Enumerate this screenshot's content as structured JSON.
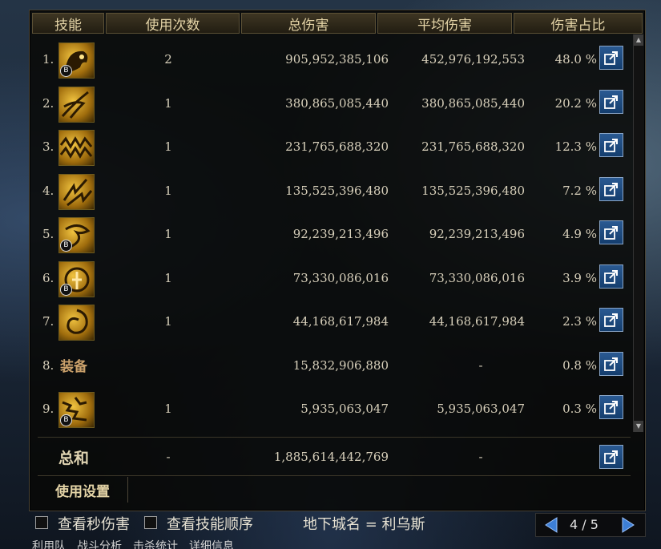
{
  "headers": [
    "技能",
    "使用次数",
    "总伤害",
    "平均伤害",
    "伤害占比"
  ],
  "rows": [
    {
      "rank": "1.",
      "uses": "2",
      "total": "905,952,385,106",
      "avg": "452,976,192,553",
      "pct": "48.0 %",
      "badge": "B",
      "icon": "beast-head-skill-icon"
    },
    {
      "rank": "2.",
      "uses": "1",
      "total": "380,865,085,440",
      "avg": "380,865,085,440",
      "pct": "20.2 %",
      "badge": "",
      "icon": "dragon-slash-skill-icon"
    },
    {
      "rank": "3.",
      "uses": "1",
      "total": "231,765,688,320",
      "avg": "231,765,688,320",
      "pct": "12.3 %",
      "badge": "",
      "icon": "zigzag-wave-skill-icon"
    },
    {
      "rank": "4.",
      "uses": "1",
      "total": "135,525,396,480",
      "avg": "135,525,396,480",
      "pct": "7.2 %",
      "badge": "",
      "icon": "lightning-burst-skill-icon"
    },
    {
      "rank": "5.",
      "uses": "1",
      "total": "92,239,213,496",
      "avg": "92,239,213,496",
      "pct": "4.9 %",
      "badge": "B",
      "icon": "dragon-claw-skill-icon"
    },
    {
      "rank": "6.",
      "uses": "1",
      "total": "73,330,086,016",
      "avg": "73,330,086,016",
      "pct": "3.9 %",
      "badge": "B",
      "icon": "vortex-figure-skill-icon"
    },
    {
      "rank": "7.",
      "uses": "1",
      "total": "44,168,617,984",
      "avg": "44,168,617,984",
      "pct": "2.3 %",
      "badge": "",
      "icon": "spiral-fist-skill-icon"
    },
    {
      "rank": "8.",
      "uses": "",
      "total": "15,832,906,880",
      "avg": "-",
      "pct": "0.8 %",
      "badge": "",
      "icon": "",
      "equip": "装备"
    },
    {
      "rank": "9.",
      "uses": "1",
      "total": "5,935,063,047",
      "avg": "5,935,063,047",
      "pct": "0.3 %",
      "badge": "B",
      "icon": "crackle-skill-icon"
    }
  ],
  "summary": {
    "label": "总和",
    "uses": "-",
    "total": "1,885,614,442,769",
    "avg": "-"
  },
  "footer_tab": "使用设置",
  "bottom": {
    "cb1_label": "查看秒伤害",
    "cb2_label": "查看技能顺序",
    "dungeon": "地下城名 = 利乌斯",
    "page": "4 / 5"
  },
  "strip": [
    "利用队",
    "战斗分析",
    "击杀统计",
    "详细信息"
  ],
  "colors": {
    "accent": "#e3d3a6",
    "share_button": "#2a5a92",
    "pager_arrow": "#3d7fd6"
  }
}
